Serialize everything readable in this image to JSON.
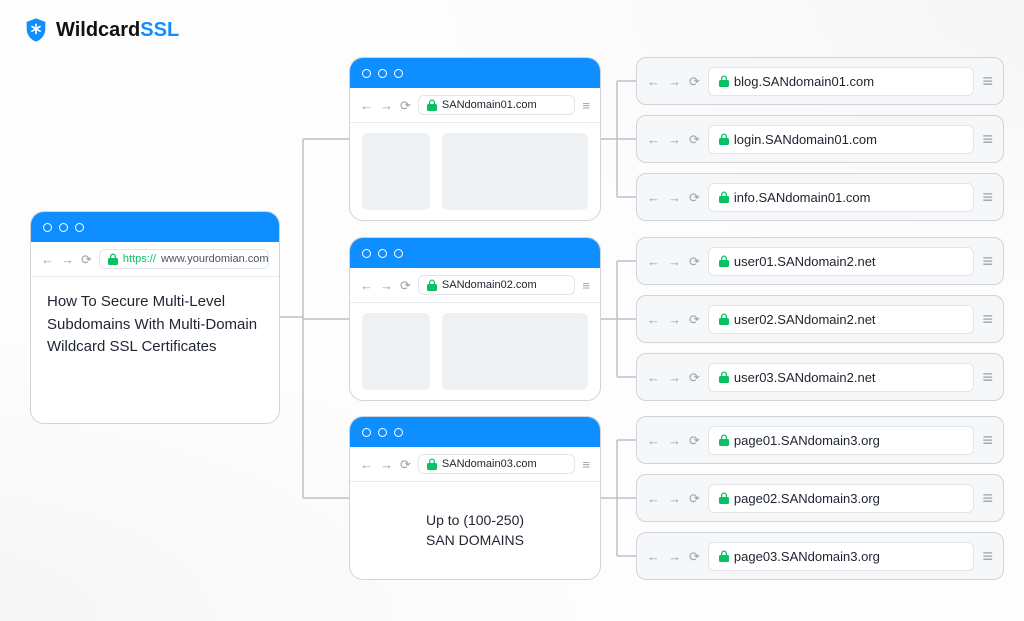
{
  "brand": {
    "part1": "Wildcard",
    "part2": "SSL"
  },
  "intro": {
    "https": "https://",
    "domain": "www.yourdomian.com",
    "title": "How To Secure Multi-Level Subdomains With Multi-Domain Wildcard SSL Certificates"
  },
  "san": {
    "d1": "SANdomain01.com",
    "d2": "SANdomain02.com",
    "d3": "SANdomain03.com",
    "note_line1": "Up to (100-250)",
    "note_line2": "SAN DOMAINS"
  },
  "subs": {
    "g1": [
      "blog.SANdomain01.com",
      "login.SANdomain01.com",
      "info.SANdomain01.com"
    ],
    "g2": [
      "user01.SANdomain2.net",
      "user02.SANdomain2.net",
      "user03.SANdomain2.net"
    ],
    "g3": [
      "page01.SANdomain3.org",
      "page02.SANdomain3.org",
      "page03.SANdomain3.org"
    ]
  }
}
